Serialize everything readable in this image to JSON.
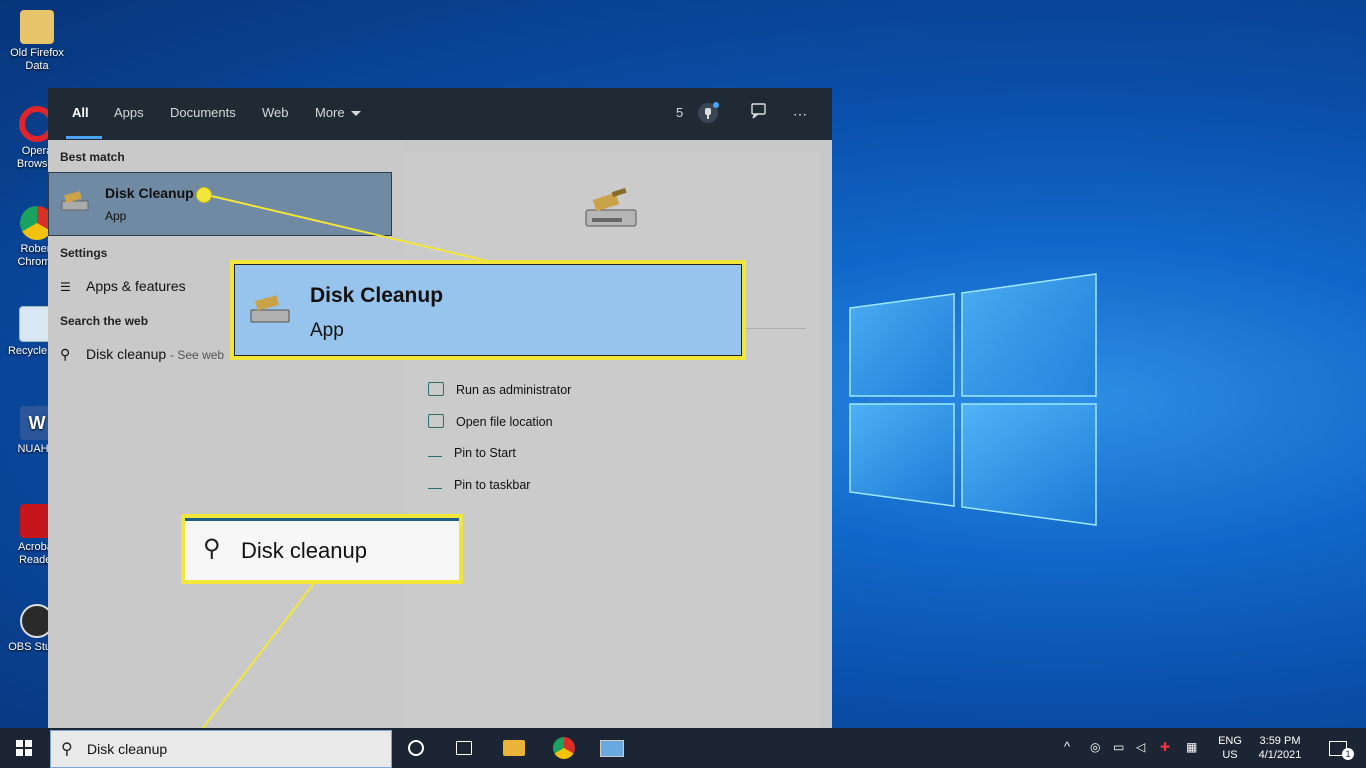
{
  "desktop": {
    "icons": [
      {
        "label": "Old Firefox Data",
        "name": "folder-icon"
      },
      {
        "label": "Opera Browser",
        "name": "opera-icon"
      },
      {
        "label": "Robert Chrome",
        "name": "chrome-icon"
      },
      {
        "label": "Recycle Bin",
        "name": "recycle-bin-icon"
      },
      {
        "label": "NUAHR",
        "name": "word-icon"
      },
      {
        "label": "Acrobat Reader",
        "name": "acrobat-icon"
      },
      {
        "label": "OBS Studio",
        "name": "obs-icon"
      }
    ]
  },
  "search_panel": {
    "tabs": [
      "All",
      "Apps",
      "Documents",
      "Web",
      "More"
    ],
    "points_count": "5",
    "best_match_title": "Best match",
    "best_match": {
      "name": "Disk Cleanup",
      "type": "App"
    },
    "settings_title": "Settings",
    "settings_items": [
      {
        "label": "Apps & features"
      }
    ],
    "web_title": "Search the web",
    "web_result": {
      "query": "Disk cleanup",
      "suffix": "- See web"
    },
    "preview_actions": [
      "Run as administrator",
      "Open file location",
      "Pin to Start",
      "Pin to taskbar"
    ]
  },
  "callouts": {
    "app_name": "Disk Cleanup",
    "app_type": "App",
    "search_text": "Disk cleanup"
  },
  "taskbar": {
    "search_value": "Disk cleanup",
    "lang_top": "ENG",
    "lang_bottom": "US",
    "time": "3:59 PM",
    "date": "4/1/2021",
    "notification_count": "1"
  },
  "colors": {
    "accent": "#4aa3ff",
    "callout_border": "#f2e63a",
    "highlight": "#6f8aa2",
    "taskbar": "#1c2533"
  }
}
